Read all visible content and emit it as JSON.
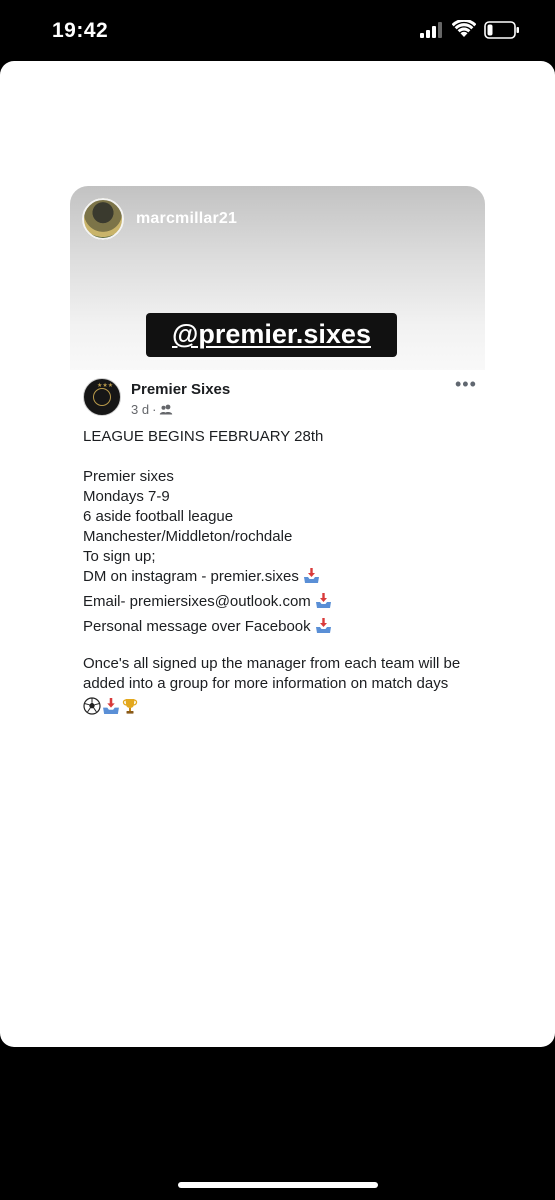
{
  "status_bar": {
    "time": "19:42"
  },
  "story": {
    "username": "marcmillar21",
    "mention": "@premier.sixes"
  },
  "post": {
    "page_name": "Premier Sixes",
    "time_ago": "3 d",
    "separator": "·",
    "audience_icon": "friends-icon",
    "lines": {
      "headline": "LEAGUE BEGINS FEBRUARY 28th",
      "l1": "Premier sixes",
      "l2": "Mondays 7-9",
      "l3": "6 aside football league",
      "l4": "Manchester/Middleton/rochdale",
      "l5": "To sign up;",
      "dm": "DM on instagram - premier.sixes",
      "email": "Email- premiersixes@outlook.com",
      "facebook": "Personal message over Facebook",
      "p2a": "Once's all signed up the manager from each team will be",
      "p2b": "added into a group for more information on match days"
    },
    "emoji_icons": [
      "soccer-ball-icon",
      "inbox-tray-icon",
      "trophy-icon"
    ]
  }
}
